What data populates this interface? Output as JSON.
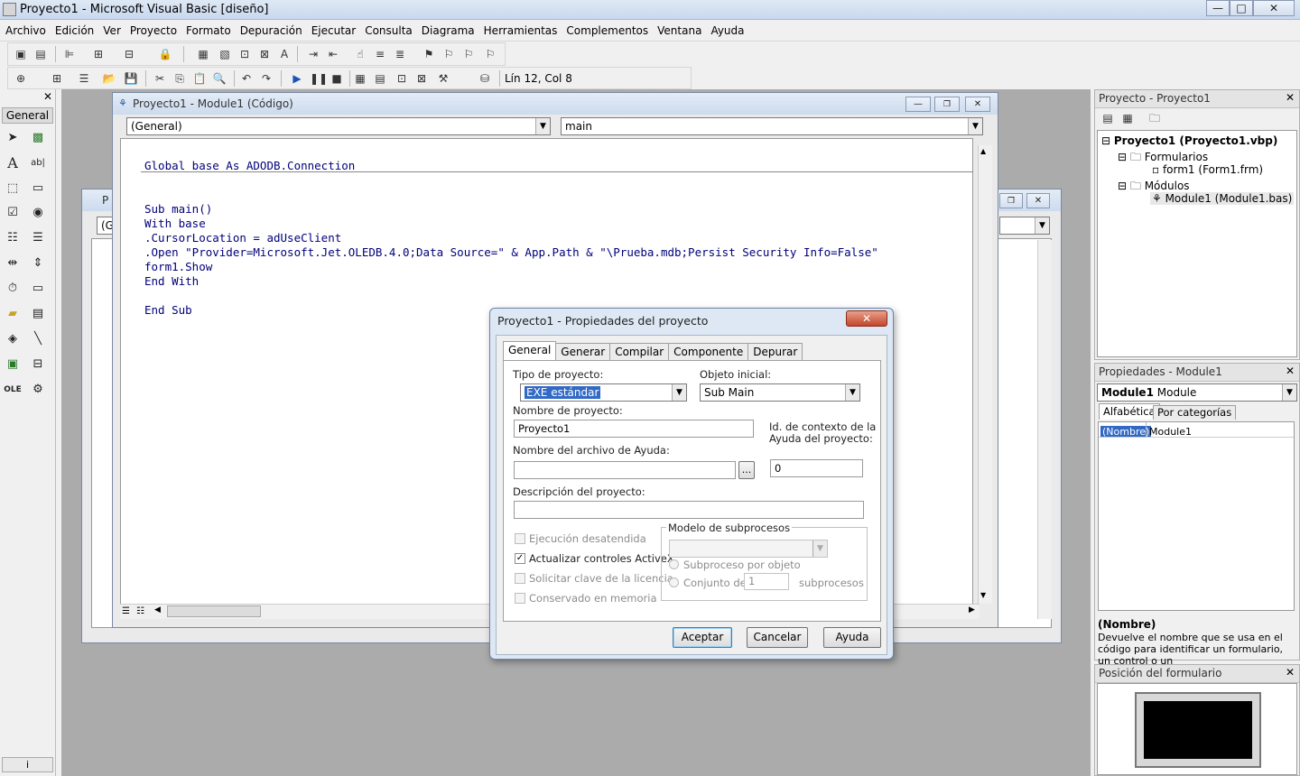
{
  "window": {
    "title": "Proyecto1 - Microsoft Visual Basic [diseño]"
  },
  "caption_buttons": {
    "minimize": "—",
    "maximize": "□",
    "close": "✕"
  },
  "menu": [
    "Archivo",
    "Edición",
    "Ver",
    "Proyecto",
    "Formato",
    "Depuración",
    "Ejecutar",
    "Consulta",
    "Diagrama",
    "Herramientas",
    "Complementos",
    "Ventana",
    "Ayuda"
  ],
  "toolbar": {
    "status": "Lín 12, Col 8"
  },
  "toolbox": {
    "header": "General",
    "footer": "i"
  },
  "code_window": {
    "title": "Proyecto1 - Module1 (Código)",
    "object_combo": "(General)",
    "proc_combo": "main",
    "lines": [
      "Global base As ADODB.Connection",
      "",
      "",
      "Sub main()",
      "With base",
      ".CursorLocation = adUseClient",
      ".Open \"Provider=Microsoft.Jet.OLEDB.4.0;Data Source=\" & App.Path & \"\\Prueba.mdb;Persist Security Info=False\"",
      "form1.Show",
      "End With",
      "",
      "End Sub"
    ]
  },
  "back_window": {
    "title_stub": "P",
    "combo_stub": "(G"
  },
  "project_pane": {
    "title": "Proyecto - Proyecto1",
    "root": "Proyecto1 (Proyecto1.vbp)",
    "folder_forms": "Formularios",
    "form1": "form1 (Form1.frm)",
    "folder_modules": "Módulos",
    "module1": "Module1 (Module1.bas)"
  },
  "properties_pane": {
    "title": "Propiedades - Module1",
    "object_bold": "Module1",
    "object_type": "Module",
    "tab_alpha": "Alfabética",
    "tab_cat": "Por categorías",
    "prop_name": "(Nombre)",
    "prop_value": "Module1",
    "desc_title": "(Nombre)",
    "desc_text": "Devuelve el nombre que se usa en el código para identificar un formulario, un control o un"
  },
  "position_pane": {
    "title": "Posición del formulario"
  },
  "dialog": {
    "title": "Proyecto1 - Propiedades del proyecto",
    "close": "✕",
    "tabs": [
      "General",
      "Generar",
      "Compilar",
      "Componente",
      "Depurar"
    ],
    "tipo_label": "Tipo de proyecto:",
    "tipo_value": "EXE estándar",
    "objeto_label": "Objeto inicial:",
    "objeto_value": "Sub Main",
    "nombre_label": "Nombre de proyecto:",
    "nombre_value": "Proyecto1",
    "idctx_label1": "Id. de contexto de la",
    "idctx_label2": "Ayuda del proyecto:",
    "idctx_value": "0",
    "ayuda_label": "Nombre del archivo de Ayuda:",
    "browse": "...",
    "desc_label": "Descripción del proyecto:",
    "chk_ejecucion": "Ejecución desatendida",
    "chk_activex": "Actualizar controles ActiveX",
    "chk_licencia": "Solicitar clave de la licencia",
    "chk_memoria": "Conservado en memoria",
    "modelo_label": "Modelo de subprocesos",
    "radio_objeto": "Subproceso por objeto",
    "radio_conjunto": "Conjunto de",
    "conjunto_value": "1",
    "subprocesos": "subprocesos",
    "btn_aceptar": "Aceptar",
    "btn_cancelar": "Cancelar",
    "btn_ayuda": "Ayuda"
  }
}
